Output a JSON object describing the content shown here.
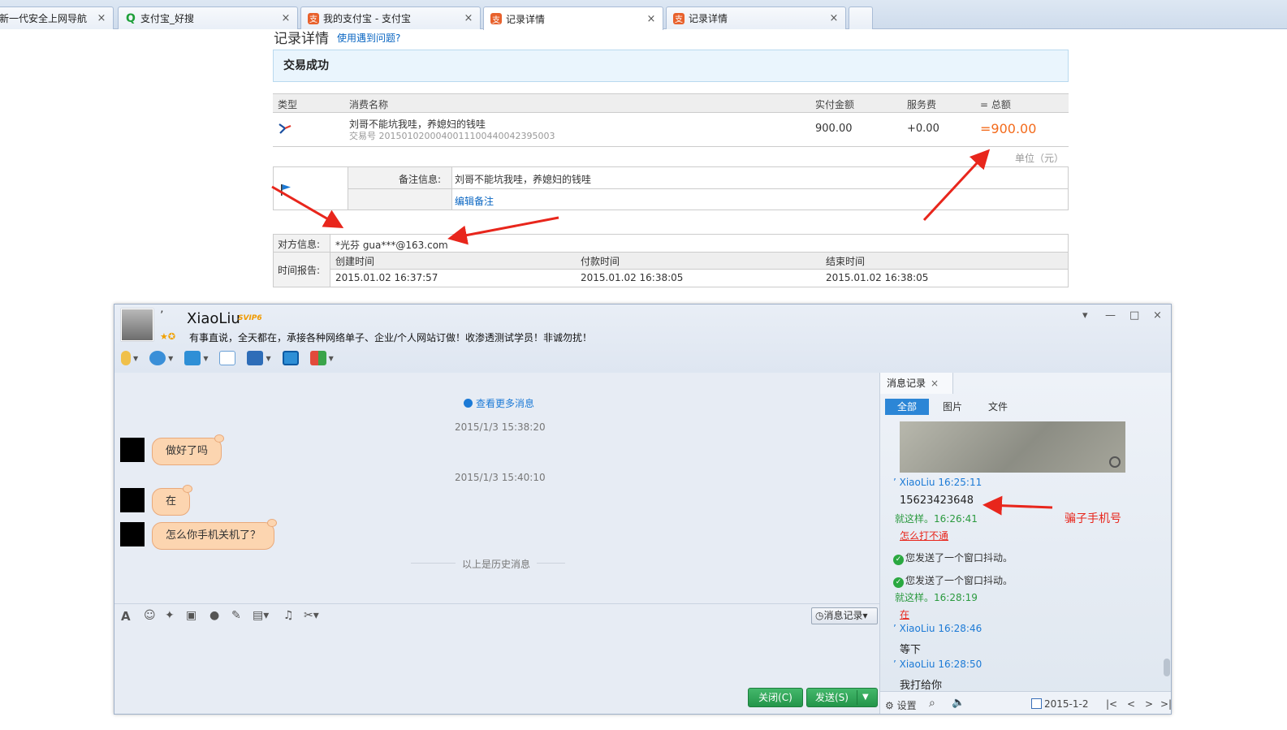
{
  "browser": {
    "tabs": [
      {
        "label": "新一代安全上网导航",
        "icon": "page-icon"
      },
      {
        "label": "支付宝_好搜",
        "icon": "search-icon"
      },
      {
        "label": "我的支付宝 - 支付宝",
        "icon": "alipay-icon"
      },
      {
        "label": "记录详情",
        "icon": "alipay-icon",
        "active": true
      },
      {
        "label": "记录详情",
        "icon": "alipay-icon"
      }
    ],
    "close_glyph": "×"
  },
  "record": {
    "title": "记录详情",
    "help_link": "使用遇到问题?",
    "status": "交易成功",
    "headers": {
      "type": "类型",
      "name": "消费名称",
      "paid": "实付金额",
      "fee": "服务费",
      "total": "= 总额"
    },
    "row": {
      "name": "刘哥不能坑我哇，养媳妇的钱哇",
      "trade_no": "交易号 2015010200040011100440042395003",
      "paid": "900.00",
      "fee": "+0.00",
      "total": "=900.00"
    },
    "unit": "单位（元）",
    "memo_label": "备注信息:",
    "memo_text": "刘哥不能坑我哇，养媳妇的钱哇",
    "memo_edit": "编辑备注",
    "counterparty_label": "对方信息:",
    "counterparty_value": "*光芬 gua***@163.com",
    "time_label": "时间报告:",
    "time_headers": [
      "创建时间",
      "付款时间",
      "结束时间"
    ],
    "time_values": [
      "2015.01.02 16:37:57",
      "2015.01.02 16:38:05",
      "2015.01.02 16:38:05"
    ]
  },
  "qq": {
    "contact_name": "XiaoLiu",
    "name_quote": "’",
    "svip_badge": "SVIP6",
    "signature": "有事直说，全天都在，承接各种网络单子、企业/个人网站订做！收渗透测试学员！非诚勿扰！",
    "window_controls": [
      "▾",
      "—",
      "□",
      "×"
    ],
    "more_messages": "查看更多消息",
    "timestamps": [
      "2015/1/3 15:38:20",
      "2015/1/3 15:40:10"
    ],
    "messages": [
      "做好了吗",
      "在",
      "怎么你手机关机了？"
    ],
    "history_divider": "以上是历史消息",
    "history_button": "消息记录",
    "close_button": "关闭(C)",
    "send_button": "发送(S)",
    "side": {
      "tab_title": "消息记录",
      "filters": [
        "全部",
        "图片",
        "文件"
      ],
      "entries": [
        {
          "kind": "sender",
          "text": "’     XiaoLiu 16:25:11"
        },
        {
          "kind": "body",
          "text": "15623423648"
        },
        {
          "kind": "me",
          "text": "就这样。16:26:41"
        },
        {
          "kind": "link",
          "text": "怎么打不通"
        },
        {
          "kind": "system",
          "text": "您发送了一个窗口抖动。"
        },
        {
          "kind": "system",
          "text": "您发送了一个窗口抖动。"
        },
        {
          "kind": "me",
          "text": "就这样。16:28:19"
        },
        {
          "kind": "link",
          "text": "在"
        },
        {
          "kind": "sender",
          "text": "’     XiaoLiu 16:28:46"
        },
        {
          "kind": "body",
          "text": "等下"
        },
        {
          "kind": "sender",
          "text": "’     XiaoLiu 16:28:50"
        },
        {
          "kind": "body",
          "text": "我打给你"
        }
      ],
      "settings_label": "设置",
      "date": "2015-1-2",
      "nav": [
        "|<",
        "<",
        ">",
        ">|"
      ]
    },
    "annotation": "骗子手机号"
  },
  "colors": {
    "accent_blue": "#1c7ad6",
    "amount_orange": "#f36b1c",
    "annotation_red": "#e8261c",
    "bubble": "#fcd5b0",
    "send_green": "#2b9a3f"
  }
}
